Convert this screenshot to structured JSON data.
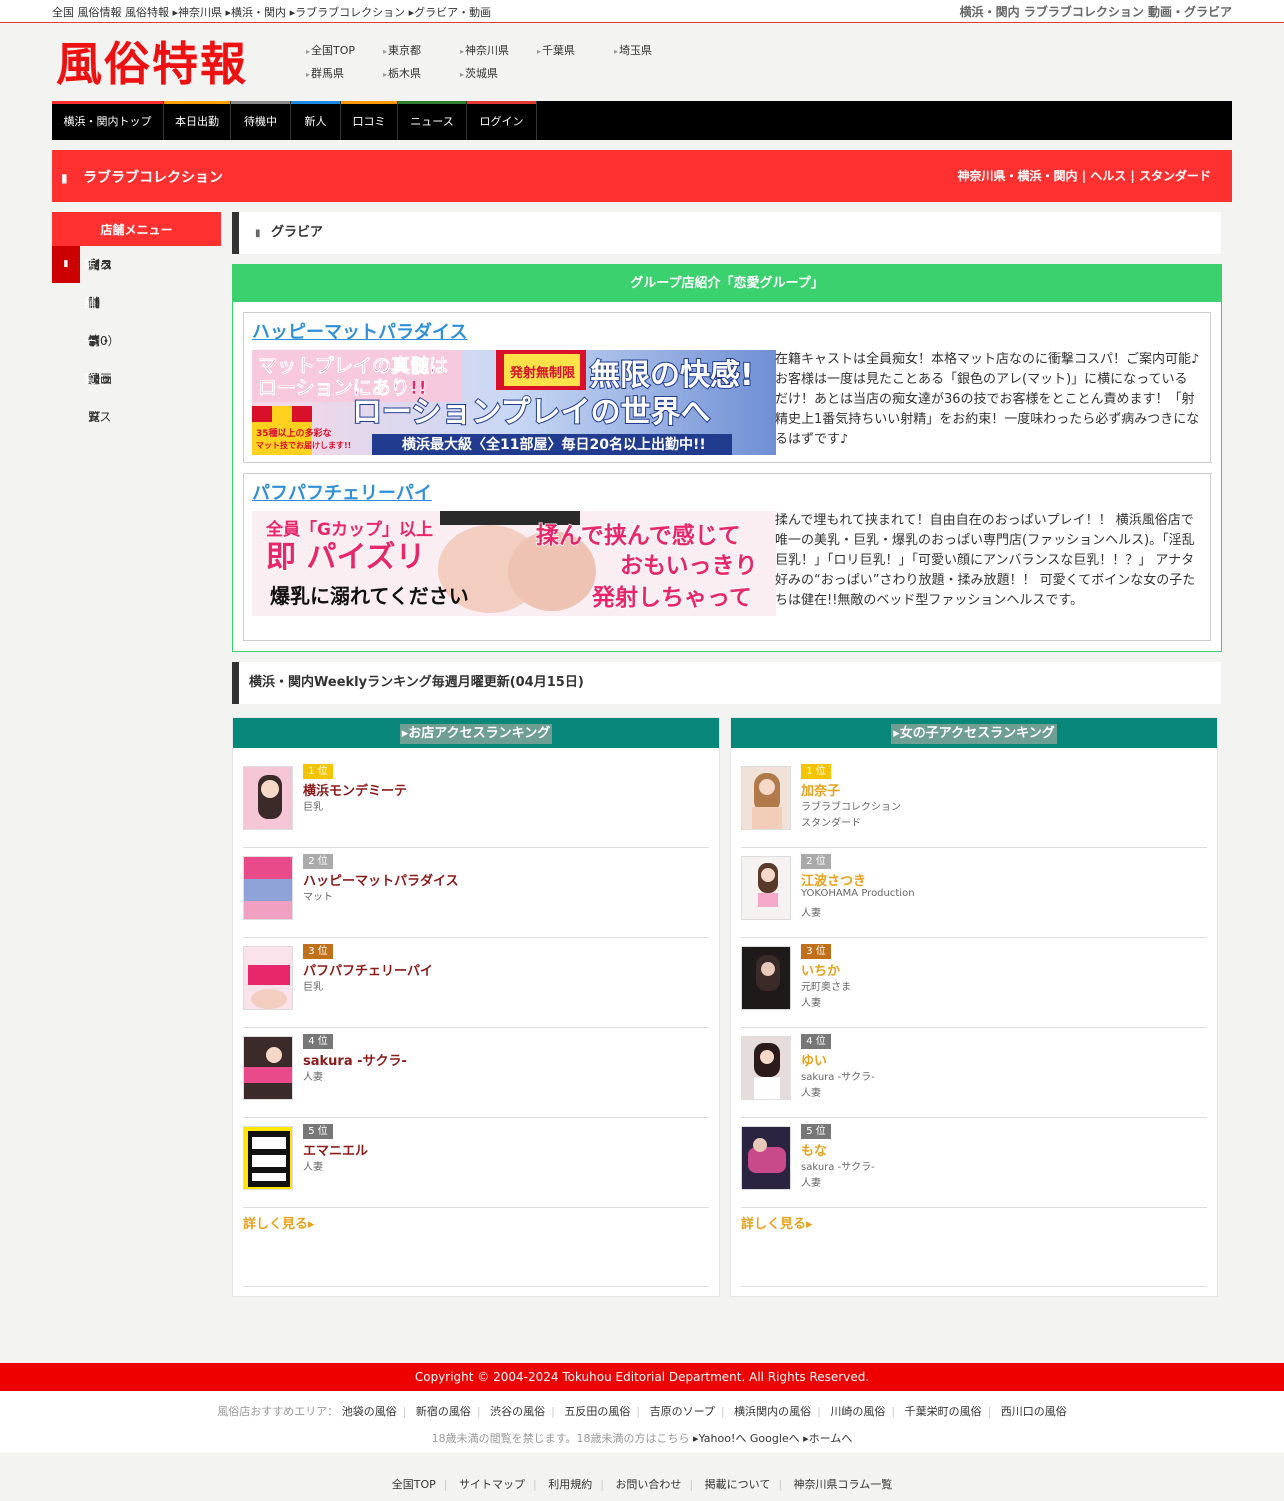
{
  "topbar": {
    "crumbs": [
      "全国 風俗情報 風俗特報",
      "▸神奈川県",
      "▸横浜・関内",
      "▸ラブラブコレクション",
      "▸グラビア・動画"
    ],
    "right_title": "横浜・関内 ラブラブコレクション 動画・グラビア"
  },
  "header": {
    "logo": "風俗特報",
    "prefectures": [
      "全国TOP",
      "東京都",
      "神奈川県",
      "千葉県",
      "埼玉県",
      "群馬県",
      "栃木県",
      "茨城県"
    ]
  },
  "gnav": {
    "items": [
      {
        "label": "横浜・関内トップ",
        "color": "#ff3030"
      },
      {
        "label": "本日出勤",
        "color": "#ffa000"
      },
      {
        "label": "待機中",
        "color": "#888888"
      },
      {
        "label": "新人",
        "color": "#1e88e5"
      },
      {
        "label": "口コミ",
        "color": "#ff9800"
      },
      {
        "label": "ニュース",
        "color": "#2e7d32"
      },
      {
        "label": "ログイン",
        "color": "#e53935"
      }
    ]
  },
  "shop": {
    "name": "ラブラブコレクション",
    "tags": "神奈川県・横浜・関内 | ヘルス | スタンダード",
    "accent": "#ff3030"
  },
  "sidebar": {
    "title": "店舗メニュー",
    "items": [
      {
        "label": "店舗ホーム"
      },
      {
        "label": "割引情報"
      },
      {
        "label": "女の子一覧"
      },
      {
        "label": "出勤情報"
      },
      {
        "label": "イベント・ニュース"
      },
      {
        "label": "グラビア・動画"
      },
      {
        "label": "口コミ（0）"
      },
      {
        "label": "システム・マップ"
      },
      {
        "label": "店舗一覧"
      }
    ]
  },
  "main": {
    "gravure_title": "グラビア",
    "group": {
      "title": "グループ店紹介「恋愛グループ」",
      "shops": [
        {
          "name": "ハッピーマットパラダイス",
          "banner": {
            "line1": "マットプレイの真髄は",
            "line2": "ローションにあり!!",
            "tag": "発射無制限",
            "big": "無限の快感!",
            "main": "ローションプレイの世界へ",
            "small1": "35種以上の多彩な",
            "small2": "マット技でお届けします!!",
            "bottom": "横浜最大級〈全11部屋〉毎日20名以上出勤中!!"
          },
          "desc": "在籍キャストは全員痴女！本格マット店なのに衝撃コスパ！ご案内可能♪お客様は一度は見たことある「銀色のアレ(マット)」に横になっているだけ！あとは当店の痴女達が36の技でお客様をとことん責めます！「射精史上1番気持ちいい射精」をお約束！一度味わったら必ず病みつきになるはずです♪"
        },
        {
          "name": "パフパフチェリーパイ",
          "banner": {
            "l1": "全員「Gカップ」以上",
            "l2": "即 パイズリ",
            "l3": "爆乳に溺れてください",
            "r1": "揉んで挟んで感じて",
            "r2": "おもいっきり",
            "r3": "発射しちゃって"
          },
          "desc": "揉んで埋もれて挟まれて！自由自在のおっぱいプレイ！！ 横浜風俗店で唯一の美乳・巨乳・爆乳のおっぱい専門店(ファッションヘルス)。「淫乱巨乳！」「ロリ巨乳！」「可愛い顔にアンバランスな巨乳！！？」 アナタ好みの“おっぱい”さわり放題・揉み放題！！ 可愛くてボインな女の子たちは健在!!無敵のベッド型ファッションヘルスです。"
        }
      ]
    },
    "ranking_title": "横浜・関内Weeklyランキング毎週月曜更新(04月15日)",
    "shop_ranking": {
      "title": "▸お店アクセスランキング",
      "rows": [
        {
          "rank": "1 位",
          "name": "横浜モンデミーテ",
          "sub1": "巨乳",
          "sub2": ""
        },
        {
          "rank": "2 位",
          "name": "ハッピーマットパラダイス",
          "sub1": "マット",
          "sub2": ""
        },
        {
          "rank": "3 位",
          "name": "パフパフチェリーパイ",
          "sub1": "巨乳",
          "sub2": ""
        },
        {
          "rank": "4 位",
          "name": "sakura -サクラ-",
          "sub1": "人妻",
          "sub2": ""
        },
        {
          "rank": "5 位",
          "name": "エマニエル",
          "sub1": "人妻",
          "sub2": ""
        }
      ],
      "more": "詳しく見る▸"
    },
    "girl_ranking": {
      "title": "▸女の子アクセスランキング",
      "rows": [
        {
          "rank": "1 位",
          "name": "加奈子",
          "sub1": "ラブラブコレクション",
          "sub2": "スタンダード"
        },
        {
          "rank": "2 位",
          "name": "江波さつき",
          "sub1": "YOKOHAMA Production",
          "sub2": "人妻"
        },
        {
          "rank": "3 位",
          "name": "いちか",
          "sub1": "元町奥さま",
          "sub2": "人妻"
        },
        {
          "rank": "4 位",
          "name": "ゆい",
          "sub1": "sakura -サクラ-",
          "sub2": "人妻"
        },
        {
          "rank": "5 位",
          "name": "もな",
          "sub1": "sakura -サクラ-",
          "sub2": "人妻"
        }
      ],
      "more": "詳しく見る▸"
    },
    "rank_colors": [
      "#f5c400",
      "#aaaaaa",
      "#c0701a",
      "#777777",
      "#777777"
    ]
  },
  "footer": {
    "copyright": "Copyright © 2004-2024 Tokuhou Editorial Department. All Rights Reserved.",
    "areas_lead": "風俗店おすすめエリア：",
    "areas": [
      "池袋の風俗",
      "新宿の風俗",
      "渋谷の風俗",
      "五反田の風俗",
      "吉原のソープ",
      "横浜関内の風俗",
      "川崎の風俗",
      "千葉栄町の風俗",
      "西川口の風俗"
    ],
    "warn": "18歳未満の閲覧を禁じます。18歳未満の方はこちら",
    "warn_links": [
      "▸Yahoo!へ",
      "Googleへ",
      "▸ホームへ"
    ],
    "links": [
      "全国TOP",
      "サイトマップ",
      "利用規約",
      "お問い合わせ",
      "掲載について",
      "神奈川県コラム一覧"
    ]
  }
}
